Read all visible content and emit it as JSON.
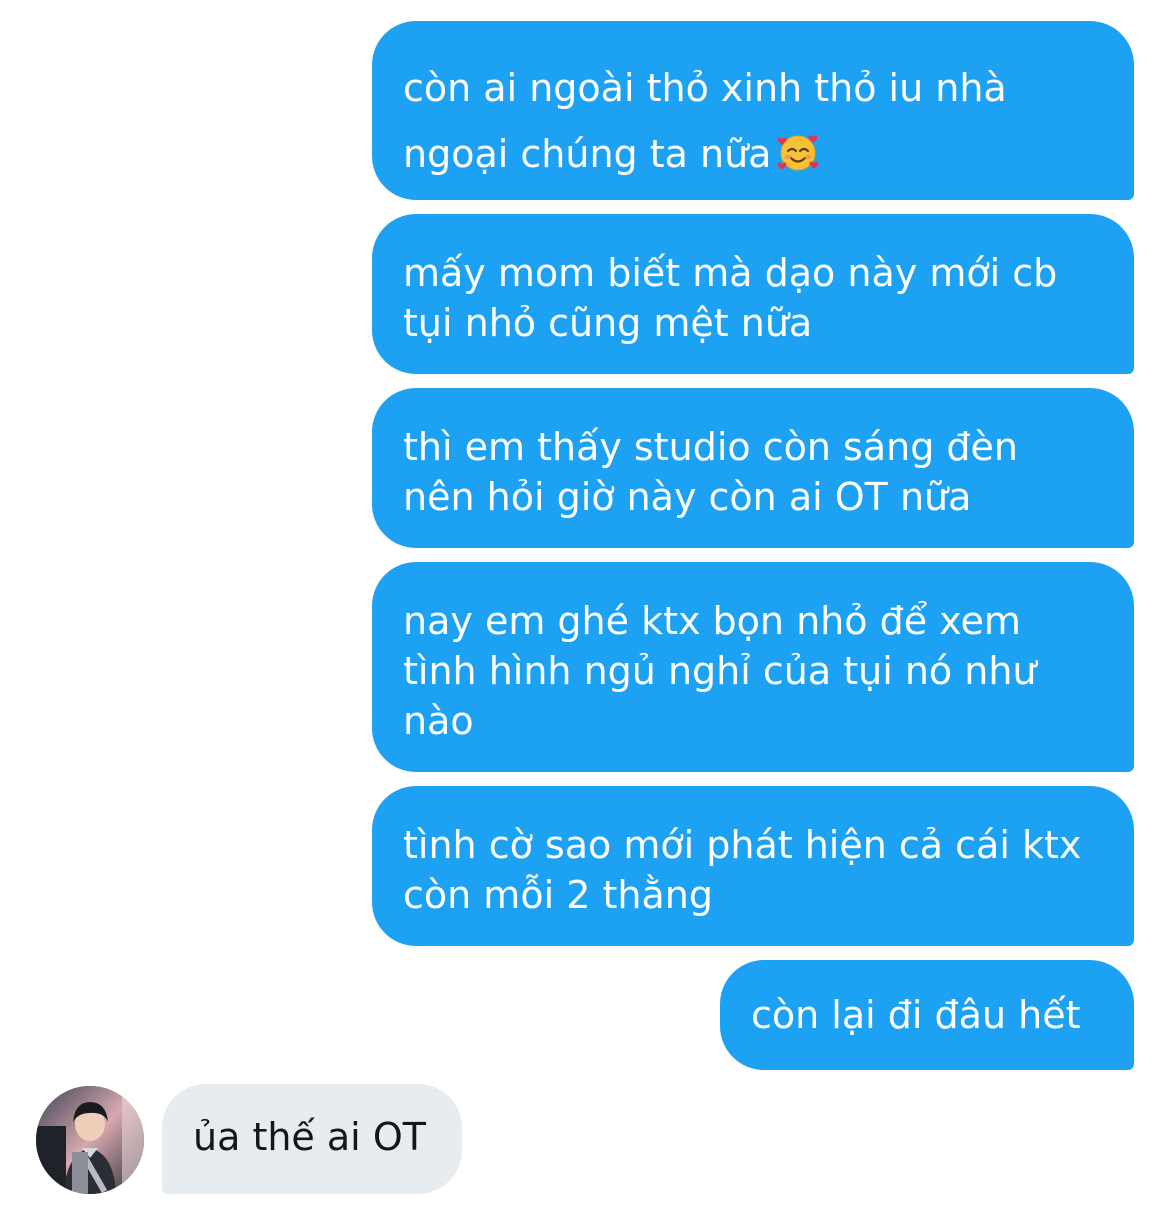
{
  "conversation": {
    "sent_messages": [
      {
        "lines": [
          "còn ai ngoài thỏ xinh thỏ iu nhà",
          "ngoại chúng ta nữa"
        ],
        "emoji": "smiling-face-with-hearts-icon"
      },
      {
        "lines": [
          "mấy mom biết mà dạo này mới cb",
          "tụi nhỏ cũng mệt nữa"
        ]
      },
      {
        "lines": [
          "thì em thấy studio còn sáng đèn",
          "nên hỏi giờ này còn ai OT nữa"
        ]
      },
      {
        "lines": [
          "nay em ghé ktx bọn nhỏ để xem",
          "tình hình ngủ nghỉ của tụi nó như",
          "nào"
        ]
      },
      {
        "lines": [
          "tình cờ sao mới phát hiện cả cái ktx",
          "còn mỗi 2 thằng"
        ]
      },
      {
        "lines": [
          "còn lại đi đâu hết"
        ]
      }
    ],
    "received_messages": [
      {
        "text": "ủa thế ai OT"
      }
    ]
  },
  "colors": {
    "sent_bubble": "#1da1f2",
    "sent_text": "#ffffff",
    "received_bubble": "#e6ecf0",
    "received_text": "#14171a"
  }
}
